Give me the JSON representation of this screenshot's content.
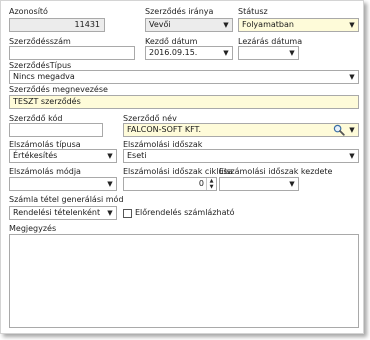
{
  "form": {
    "azonosito": {
      "label": "Azonosító",
      "value": "11431"
    },
    "irany": {
      "label": "Szerződés iránya",
      "value": "Vevői"
    },
    "statusz": {
      "label": "Státusz",
      "value": "Folyamatban"
    },
    "szerzodesszam": {
      "label": "Szerződésszám",
      "value": ""
    },
    "kezdo_datum": {
      "label": "Kezdő dátum",
      "value": "2016.09.15."
    },
    "lezaras_datuma": {
      "label": "Lezárás dátuma",
      "value": ""
    },
    "tipus": {
      "label": "SzerződésTípus",
      "value": "Nincs megadva"
    },
    "megnevezes": {
      "label": "Szerződés megnevezése",
      "value": "TESZT szerződés"
    },
    "szerzodo_kod": {
      "label": "Szerződő kód",
      "value": ""
    },
    "szerzodo_nev": {
      "label": "Szerződő név",
      "value": "FALCON-SOFT KFT."
    },
    "elszamolas_tipusa": {
      "label": "Elszámolás típusa",
      "value": "Értékesítés"
    },
    "elszamolasi_idoszak": {
      "label": "Elszámolási időszak",
      "value": "Eseti"
    },
    "elszamolas_modja": {
      "label": "Elszámolás módja",
      "value": ""
    },
    "idoszak_ciklusa": {
      "label": "Elszámolási időszak ciklusa",
      "value": "0"
    },
    "idoszak_kezdete": {
      "label": "Elszámolási időszak kezdete",
      "value": ""
    },
    "szamla_mod": {
      "label": "Számla tétel generálási mód",
      "value": "Rendelési tételenként"
    },
    "elorendeles": {
      "label": "Előrendelés számlázható",
      "checked": false
    },
    "megjegyzes": {
      "label": "Megjegyzés",
      "value": ""
    }
  },
  "icons": {
    "dropdown": "chevron-down-icon",
    "search": "magnifier-icon"
  },
  "colors": {
    "highlight_field": "#fefbd9",
    "readonly_field": "#ececec"
  }
}
